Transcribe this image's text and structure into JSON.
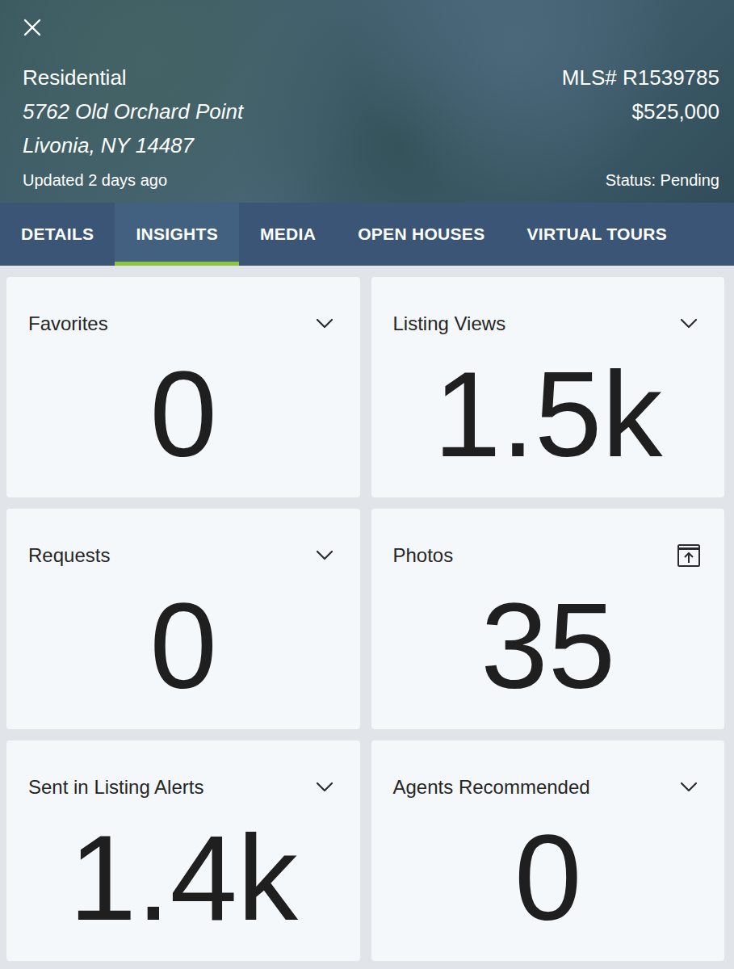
{
  "listing": {
    "type": "Residential",
    "address_line1": "5762 Old Orchard Point",
    "address_line2": "Livonia, NY 14487",
    "updated": "Updated 2 days ago",
    "mls": "MLS# R1539785",
    "price": "$525,000",
    "status": "Status: Pending"
  },
  "tabs": [
    {
      "label": "DETAILS",
      "selected": false
    },
    {
      "label": "INSIGHTS",
      "selected": true
    },
    {
      "label": "MEDIA",
      "selected": false
    },
    {
      "label": "OPEN HOUSES",
      "selected": false
    },
    {
      "label": "VIRTUAL TOURS",
      "selected": false
    }
  ],
  "cards": [
    {
      "title": "Favorites",
      "value": "0",
      "kind": "dropdown"
    },
    {
      "title": "Listing Views",
      "value": "1.5k",
      "kind": "dropdown"
    },
    {
      "title": "Requests",
      "value": "0",
      "kind": "dropdown"
    },
    {
      "title": "Photos",
      "value": "35",
      "kind": "export"
    },
    {
      "title": "Sent in Listing Alerts",
      "value": "1.4k",
      "kind": "dropdown"
    },
    {
      "title": "Agents Recommended",
      "value": "0",
      "kind": "dropdown"
    }
  ]
}
